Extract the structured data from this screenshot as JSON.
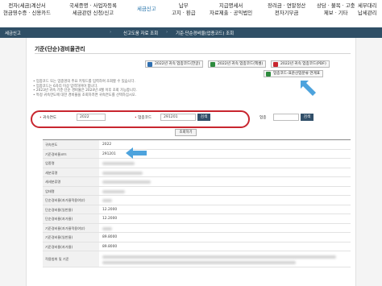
{
  "nav": [
    {
      "line1": "전자(세금)계산서",
      "line2": "현금영수증 · 신용카드"
    },
    {
      "line1": "국세증명 · 사업자등록",
      "line2": "세금관련 신청/신고"
    },
    {
      "line1": "세금신고",
      "line2": ""
    },
    {
      "line1": "납부",
      "line2": "고지 · 환급"
    },
    {
      "line1": "지급명세서",
      "line2": "자료제출 · 공익법인"
    },
    {
      "line1": "장려금 · 연말정산",
      "line2": "전자기부금"
    },
    {
      "line1": "상담 · 불복 · 고충",
      "line2": "제보 · 기타"
    },
    {
      "line1": "세무대리",
      "line2": "납세관리"
    }
  ],
  "breadcrumb": {
    "home": "세금신고",
    "level1": "신고도움 자료 조회",
    "level2": "기준·단순경비율(업종코드) 조회"
  },
  "page_title": "기준(단순)경비율관리",
  "downloads": [
    {
      "label": "2022년 귀속 업종코드(한글)",
      "icon_color": "#2f6fb0"
    },
    {
      "label": "2022년 귀속 업종코드(엑셀)",
      "icon_color": "#2e8b3e"
    },
    {
      "label": "2022년 귀속 업종코드(PDF)",
      "icon_color": "#c8262f"
    },
    {
      "label": "업종코드-표준산업분류 연계표",
      "icon_color": "#2e8b3e"
    }
  ],
  "notes": [
    "• 업종코드 또는 업종명의 주요 키워드를 입력하여 조회할 수 있습니다.",
    "  • 업종코드는 6자리 이상 입력하여야 합니다.",
    "• 2023년 귀속 기준·단순 경비율은 2024년 4월 이후 조회 가능합니다.",
    "  • 특정 귀속연도에 대한 경비율을 조회하려면 귀속연도를 선택하십시오."
  ],
  "search": {
    "year_label": "귀속연도",
    "year_value": "2022",
    "code_label": "업종코드",
    "code_value": "291201",
    "search_button": "검색",
    "name_label": "업종",
    "name_value": "",
    "name_search_button": "검색",
    "apply_button": "조회하기"
  },
  "table": [
    {
      "label": "귀속연도",
      "value": "2022",
      "blur": 0
    },
    {
      "label": "기준경비율코드",
      "value": "291201",
      "blur": 0
    },
    {
      "label": "업종명",
      "value": "",
      "blur": 40
    },
    {
      "label": "세분류명",
      "value": "",
      "blur": 50
    },
    {
      "label": "세세분류명",
      "value": "",
      "blur": 60
    },
    {
      "label": "업태명",
      "value": "",
      "blur": 28
    },
    {
      "label": "단순경비율(자가율적용여부)",
      "value": "",
      "blur": 12
    },
    {
      "label": "단순경비율(일반율)",
      "value": "12.2000",
      "blur": 0
    },
    {
      "label": "단순경비율(자가율)",
      "value": "12.2000",
      "blur": 0
    },
    {
      "label": "기준경비율(자가율적용여부)",
      "value": "",
      "blur": 12
    },
    {
      "label": "기준경비율(일반율)",
      "value": "89.8000",
      "blur": 0
    },
    {
      "label": "기준경비율(자가율)",
      "value": "89.8000",
      "blur": 0
    }
  ],
  "last_row_label": "적용범위 및 기준",
  "colors": {
    "nav_active": "#1f6fa8",
    "breadcrumb_bg": "#2f4f66",
    "highlight_oval": "#c8262f",
    "arrow": "#4da3dd",
    "search_button": "#32506a"
  }
}
